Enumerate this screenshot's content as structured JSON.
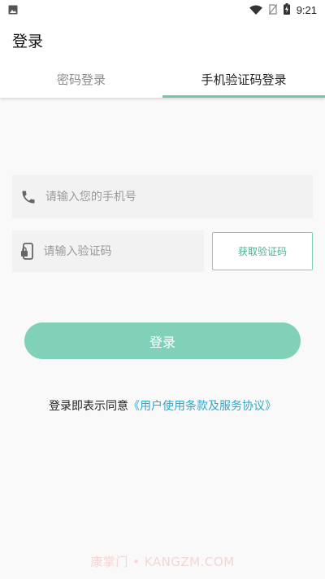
{
  "status_bar": {
    "time": "9:21",
    "icons": [
      "image-icon",
      "wifi-icon",
      "no-sim-icon",
      "battery-charging-icon"
    ]
  },
  "app_bar": {
    "title": "登录"
  },
  "tabs": [
    {
      "label": "密码登录",
      "active": false
    },
    {
      "label": "手机验证码登录",
      "active": true
    }
  ],
  "form": {
    "phone_placeholder": "请输入您的手机号",
    "phone_value": "",
    "code_placeholder": "请输入验证码",
    "code_value": "",
    "get_code_label": "获取验证码",
    "login_label": "登录"
  },
  "agreement": {
    "prefix": "登录即表示同意",
    "link": "《用户使用条款及服务协议》"
  },
  "watermark": "康掌门 • KANGZM.COM",
  "colors": {
    "accent": "#80d1b8",
    "accent_border": "#7fcfb7",
    "link": "#2fa7c9",
    "field_bg": "#f2f2f2"
  }
}
